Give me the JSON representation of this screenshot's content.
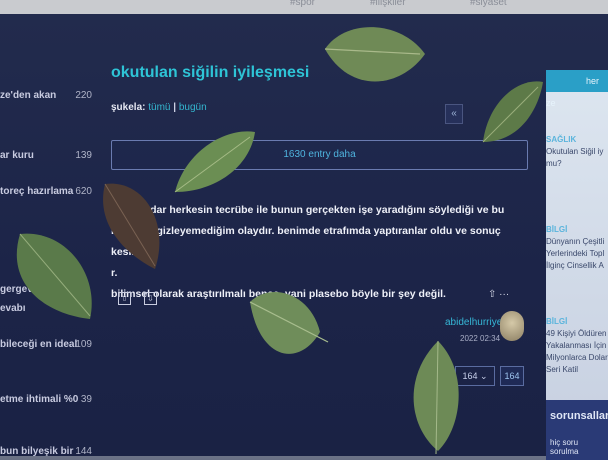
{
  "topbar": {
    "items": [
      "#spor",
      "#ilişkiler",
      "#siyaset"
    ]
  },
  "sidebar": {
    "items": [
      {
        "label": "ze'den akan",
        "count": "220"
      },
      {
        "label": "ar kuru",
        "count": "139"
      },
      {
        "label": "toreç hazırlama",
        "count": "620"
      },
      {
        "label": "gergev",
        "count": ""
      },
      {
        "label": "evabı",
        "count": ""
      },
      {
        "label": "bileceği en ideal",
        "count": "109"
      },
      {
        "label": "etme ihtimali %0",
        "count": "39"
      },
      {
        "label": "bun bilyeşik bir",
        "count": "144"
      }
    ]
  },
  "main": {
    "title": "okutulan siğilin iyileşmesi",
    "filter_label": "şukela:",
    "filter_all": "tümü",
    "filter_sep": "|",
    "filter_today": "bugün",
    "pager_prev": "«",
    "more_entries": "1630 entry daha",
    "entry_lines": [
      "d    ine kadar herkesin tecrübe ile bunun gerçekten işe yaradığını söylediği ve bu",
      "    kınlığımı gizleyemediğim olaydır. benimde etrafımda yaptıranlar oldu ve sonuç kesin,",
      "    r.",
      "bilimsel olarak araştırılmalı bence. yani plasebo böyle bir şey değil."
    ],
    "author": "abidelhurriyet",
    "date": "2022 02:34",
    "page_select": "164",
    "page_total": "164",
    "share_icons": "⇧  ···"
  },
  "right": {
    "header": "her ze",
    "blocks": [
      {
        "tag": "SAĞLIK",
        "text": [
          "Okutulan Siğil iy",
          "mu?"
        ]
      },
      {
        "tag": "BİLGİ",
        "text": [
          "Dünyanın Çeşitli",
          "Yerlerindeki Topl",
          "İlginç Cinsellik A"
        ]
      },
      {
        "tag": "BİLGİ",
        "text": [
          "49 Kişiyi Öldüren",
          "Yakalanması İçin",
          "Milyonlarca Dolar",
          "Seri Katil"
        ]
      }
    ],
    "sorunsal_title": "sorunsallar",
    "sorunsal_sub": "hiç soru sorulma"
  }
}
